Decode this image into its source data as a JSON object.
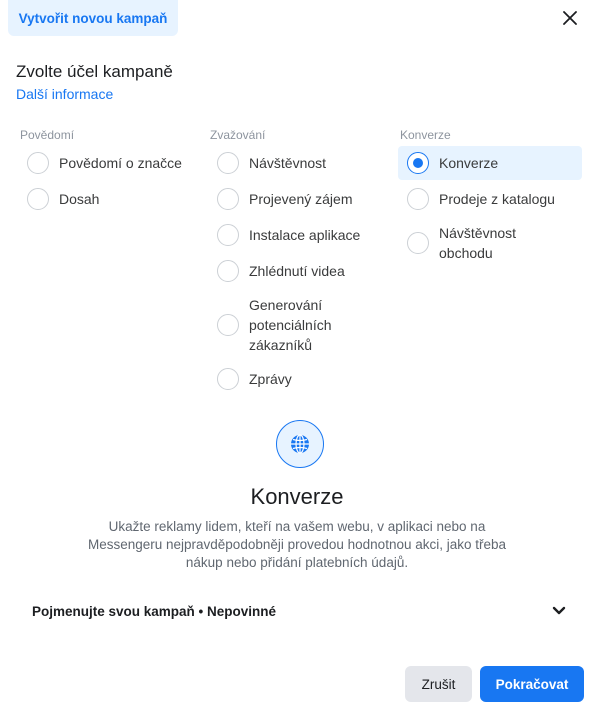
{
  "header": {
    "title": "Vytvořit novou kampaň"
  },
  "heading": "Zvolte účel kampaně",
  "more_info": "Další informace",
  "columns": [
    {
      "title": "Povědomí",
      "options": [
        {
          "label": "Povědomí o značce",
          "selected": false
        },
        {
          "label": "Dosah",
          "selected": false
        }
      ]
    },
    {
      "title": "Zvažování",
      "options": [
        {
          "label": "Návštěvnost",
          "selected": false
        },
        {
          "label": "Projevený zájem",
          "selected": false
        },
        {
          "label": "Instalace aplikace",
          "selected": false
        },
        {
          "label": "Zhlédnutí videa",
          "selected": false
        },
        {
          "label": "Generování potenciálních zákazníků",
          "selected": false
        },
        {
          "label": "Zprávy",
          "selected": false
        }
      ]
    },
    {
      "title": "Konverze",
      "options": [
        {
          "label": "Konverze",
          "selected": true
        },
        {
          "label": "Prodeje z katalogu",
          "selected": false
        },
        {
          "label": "Návštěvnost obchodu",
          "selected": false
        }
      ]
    }
  ],
  "detail": {
    "icon": "globe-icon",
    "title": "Konverze",
    "description": "Ukažte reklamy lidem, kteří na vašem webu, v aplikaci nebo na Messengeru nejpravděpodobněji provedou hodnotnou akci, jako třeba nákup nebo přidání platebních údajů."
  },
  "name_section": {
    "label": "Pojmenujte svou kampaň • Nepovinné"
  },
  "buttons": {
    "cancel": "Zrušit",
    "continue": "Pokračovat"
  },
  "colors": {
    "accent": "#1877f2",
    "selected_bg": "#e7f3ff",
    "cancel_bg": "#e4e6eb"
  }
}
